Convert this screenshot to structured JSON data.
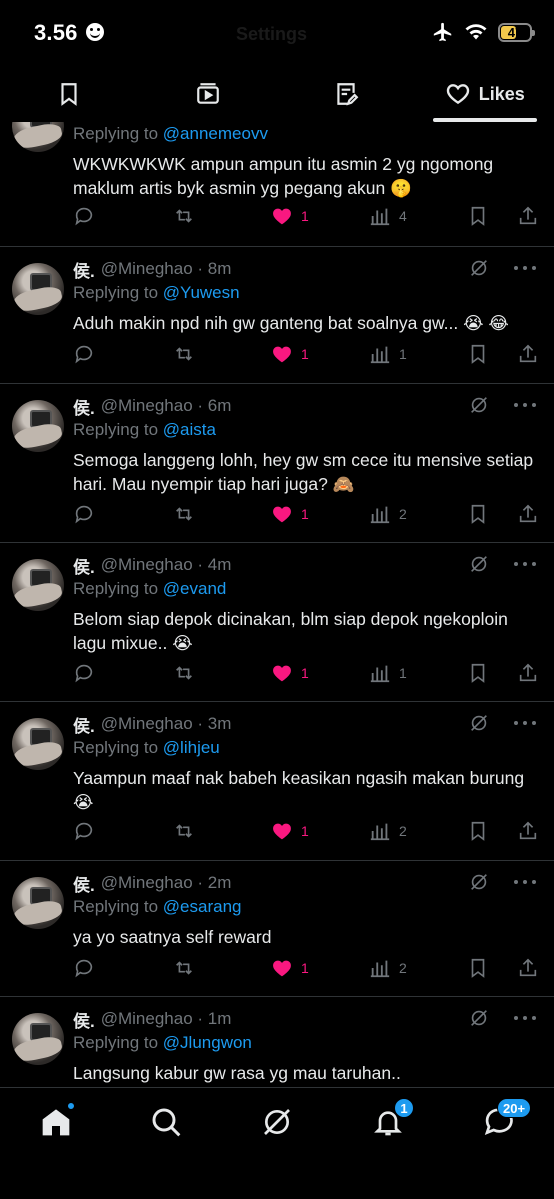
{
  "status_bar": {
    "time": "3.56",
    "faded_title": "Settings",
    "battery": "47"
  },
  "tabs": [
    {
      "icon": "bookmark-icon",
      "label": ""
    },
    {
      "icon": "media-icon",
      "label": ""
    },
    {
      "icon": "articles-icon",
      "label": ""
    },
    {
      "icon": "heart-icon",
      "label": "Likes"
    }
  ],
  "posts": [
    {
      "name": "",
      "handle": "",
      "time": "",
      "reply_to_prefix": "Replying to",
      "reply_to": "@annemeovv",
      "text": "WKWKWKWK ampun ampun itu asmin 2 yg ngomong maklum artis byk asmin yg pegang akun 🤫",
      "likes": "1",
      "views": "4"
    },
    {
      "name": "侯.",
      "handle": "@Mineghao",
      "time": "8m",
      "reply_to_prefix": "Replying to",
      "reply_to": "@Yuwesn",
      "text": "Aduh makin npd nih gw ganteng bat soalnya gw... 😭 😂",
      "likes": "1",
      "views": "1"
    },
    {
      "name": "侯.",
      "handle": "@Mineghao",
      "time": "6m",
      "reply_to_prefix": "Replying to",
      "reply_to": "@aista",
      "text": "Semoga langgeng lohh, hey gw sm cece itu mensive setiap hari. Mau nyempir tiap hari juga? 🙈",
      "likes": "1",
      "views": "2"
    },
    {
      "name": "侯.",
      "handle": "@Mineghao",
      "time": "4m",
      "reply_to_prefix": "Replying to",
      "reply_to": "@evand",
      "text": "Belom siap depok dicinakan, blm siap depok ngekoploin lagu mixue.. 😭",
      "likes": "1",
      "views": "1"
    },
    {
      "name": "侯.",
      "handle": "@Mineghao",
      "time": "3m",
      "reply_to_prefix": "Replying to",
      "reply_to": "@lihjeu",
      "text": "Yaampun maaf nak babeh keasikan ngasih makan burung 😭",
      "likes": "1",
      "views": "2"
    },
    {
      "name": "侯.",
      "handle": "@Mineghao",
      "time": "2m",
      "reply_to_prefix": "Replying to",
      "reply_to": "@esarang",
      "text": "ya yo saatnya self reward",
      "likes": "1",
      "views": "2"
    },
    {
      "name": "侯.",
      "handle": "@Mineghao",
      "time": "1m",
      "reply_to_prefix": "Replying to",
      "reply_to": "@Jlungwon",
      "text": "Langsung kabur gw rasa yg mau taruhan..",
      "likes": "",
      "views": ""
    }
  ],
  "bottom_nav": {
    "items": [
      "home-icon",
      "search-icon",
      "grok-icon",
      "notifications-icon",
      "messages-icon"
    ],
    "notifications_badge": "1",
    "messages_badge": "20+"
  },
  "colors": {
    "like": "#f91880",
    "link": "#1d9bf0",
    "muted": "#71767b",
    "divider": "#2f3336"
  }
}
